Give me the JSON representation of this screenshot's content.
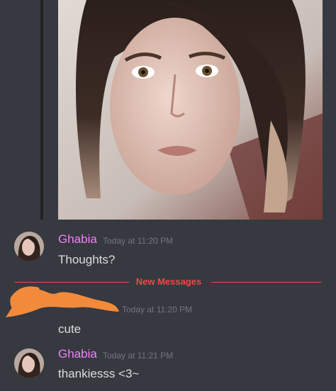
{
  "messages": [
    {
      "username": "Ghabia",
      "timestamp": "Today at 11:20 PM",
      "content": "Thoughts?"
    },
    {
      "username": "",
      "timestamp": "Today at 11:20 PM",
      "content": "cute"
    },
    {
      "username": "Ghabia",
      "timestamp": "Today at 11:21 PM",
      "content": "thankiesss <3~"
    }
  ],
  "divider": {
    "label": "New Messages"
  },
  "colors": {
    "background": "#36393f",
    "username": "#f47fff",
    "new_messages": "#f04747",
    "timestamp": "#72767d",
    "text": "#dcddde",
    "redaction": "#f28a3b"
  }
}
